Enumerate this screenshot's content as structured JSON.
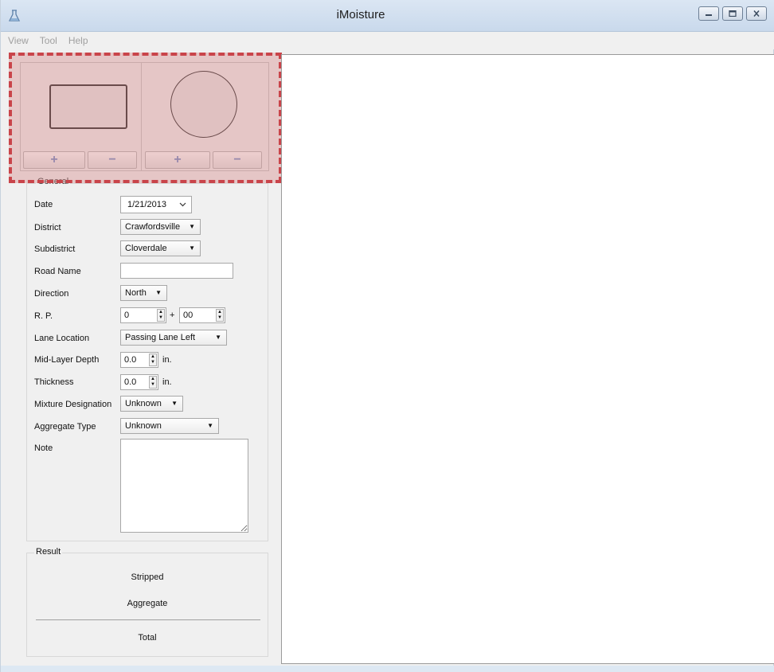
{
  "window": {
    "title": "iMoisture",
    "icon": "flask-icon"
  },
  "menu": [
    {
      "label": "View"
    },
    {
      "label": "Tool"
    },
    {
      "label": "Help"
    }
  ],
  "shapes": {
    "add_symbol": "+",
    "remove_symbol": "−"
  },
  "general": {
    "title": "General",
    "date_label": "Date",
    "date_value": "1/21/2013",
    "district_label": "District",
    "district_value": "Crawfordsville",
    "subdistrict_label": "Subdistrict",
    "subdistrict_value": "Cloverdale",
    "road_name_label": "Road Name",
    "road_name_value": "",
    "direction_label": "Direction",
    "direction_value": "North",
    "rp_label": "R. P.",
    "rp_major": "0",
    "rp_plus": "+",
    "rp_minor": "00",
    "lane_label": "Lane Location",
    "lane_value": "Passing Lane Left",
    "midlayer_label": "Mid-Layer Depth",
    "midlayer_value": "0.0",
    "midlayer_unit": "in.",
    "thickness_label": "Thickness",
    "thickness_value": "0.0",
    "thickness_unit": "in.",
    "mixture_label": "Mixture Designation",
    "mixture_value": "Unknown",
    "aggregate_label": "Aggregate Type",
    "aggregate_value": "Unknown",
    "note_label": "Note",
    "note_value": ""
  },
  "result": {
    "title": "Result",
    "stripped": "Stripped",
    "aggregate": "Aggregate",
    "total": "Total"
  }
}
